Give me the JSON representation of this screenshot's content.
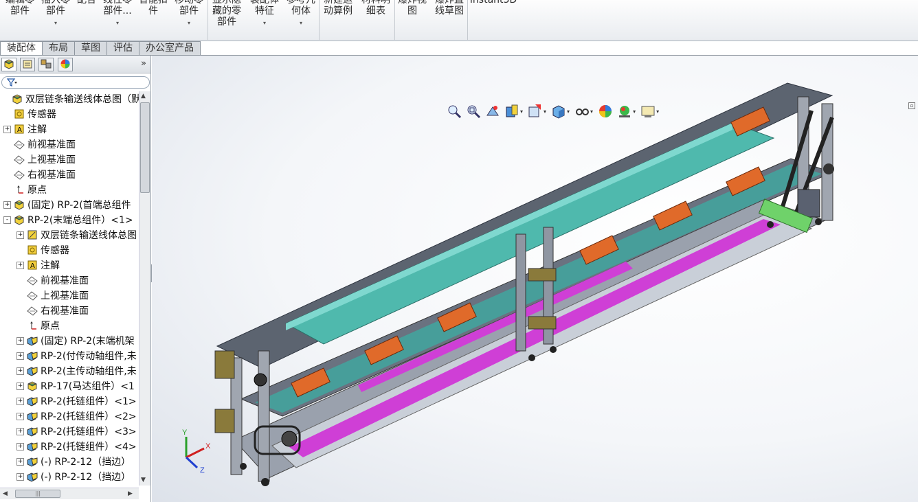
{
  "ribbon": {
    "buttons": [
      {
        "label": "编辑零\n部件",
        "dropdown": false
      },
      {
        "label": "插入零\n部件",
        "dropdown": true
      },
      {
        "label": "配合",
        "dropdown": false
      },
      {
        "label": "线性零\n部件...",
        "dropdown": true
      },
      {
        "label": "智能扣\n件",
        "dropdown": false
      },
      {
        "label": "移动零\n部件",
        "dropdown": true
      },
      {
        "label": "显示隐\n藏的零\n部件",
        "dropdown": false
      },
      {
        "label": "装配体\n特征",
        "dropdown": true
      },
      {
        "label": "参考几\n何体",
        "dropdown": true
      },
      {
        "label": "新建运\n动算例",
        "dropdown": false
      },
      {
        "label": "材料明\n细表",
        "dropdown": false
      },
      {
        "label": "爆炸视\n图",
        "dropdown": false
      },
      {
        "label": "爆炸直\n线草图",
        "dropdown": false
      },
      {
        "label": "Instant3D",
        "dropdown": false
      }
    ]
  },
  "tabs": [
    "装配体",
    "布局",
    "草图",
    "评估",
    "办公室产品"
  ],
  "panel": {
    "chevron": "»",
    "filter_icon": "funnel-icon"
  },
  "tree": [
    {
      "label": "双层链条输送线体总图（默",
      "icon": "assembly-icon",
      "expander": "none",
      "level": 0
    },
    {
      "label": "传感器",
      "icon": "sensor-icon",
      "expander": "none",
      "level": 1
    },
    {
      "label": "注解",
      "icon": "annotation-icon",
      "expander": "+",
      "level": 1
    },
    {
      "label": "前视基准面",
      "icon": "plane-icon",
      "expander": "none",
      "level": 1
    },
    {
      "label": "上视基准面",
      "icon": "plane-icon",
      "expander": "none",
      "level": 1
    },
    {
      "label": "右视基准面",
      "icon": "plane-icon",
      "expander": "none",
      "level": 1
    },
    {
      "label": "原点",
      "icon": "origin-icon",
      "expander": "none",
      "level": 1
    },
    {
      "label": "(固定) RP-2(首端总组件",
      "icon": "subassembly-icon",
      "expander": "+",
      "level": 1
    },
    {
      "label": "RP-2(末端总组件）<1>",
      "icon": "subassembly-icon",
      "expander": "-",
      "level": 1
    },
    {
      "label": "双层链条输送线体总图",
      "icon": "history-icon",
      "expander": "+",
      "level": 2
    },
    {
      "label": "传感器",
      "icon": "sensor-icon",
      "expander": "none",
      "level": 2
    },
    {
      "label": "注解",
      "icon": "annotation-icon",
      "expander": "+",
      "level": 2
    },
    {
      "label": "前视基准面",
      "icon": "plane-icon",
      "expander": "none",
      "level": 2
    },
    {
      "label": "上视基准面",
      "icon": "plane-icon",
      "expander": "none",
      "level": 2
    },
    {
      "label": "右视基准面",
      "icon": "plane-icon",
      "expander": "none",
      "level": 2
    },
    {
      "label": "原点",
      "icon": "origin-icon",
      "expander": "none",
      "level": 2
    },
    {
      "label": "(固定) RP-2(末端机架",
      "icon": "component-icon",
      "expander": "+",
      "level": 2
    },
    {
      "label": "RP-2(付传动轴组件,未",
      "icon": "component-icon",
      "expander": "+",
      "level": 2
    },
    {
      "label": "RP-2(主传动轴组件,未",
      "icon": "component-icon",
      "expander": "+",
      "level": 2
    },
    {
      "label": "RP-17(马达组件）<1",
      "icon": "subassembly-icon",
      "expander": "+",
      "level": 2
    },
    {
      "label": "RP-2(托链组件）<1>",
      "icon": "component-icon",
      "expander": "+",
      "level": 2
    },
    {
      "label": "RP-2(托链组件）<2>",
      "icon": "component-icon",
      "expander": "+",
      "level": 2
    },
    {
      "label": "RP-2(托链组件）<3>",
      "icon": "component-icon",
      "expander": "+",
      "level": 2
    },
    {
      "label": "RP-2(托链组件）<4>",
      "icon": "component-icon",
      "expander": "+",
      "level": 2
    },
    {
      "label": "(-) RP-2-12（挡边）",
      "icon": "component-icon",
      "expander": "+",
      "level": 2
    },
    {
      "label": "(-) RP-2-12（挡边）",
      "icon": "component-icon",
      "expander": "+",
      "level": 2
    }
  ],
  "hud": [
    "zoom-to-fit-icon",
    "zoom-area-icon",
    "previous-view-icon",
    "section-view-icon",
    "view-orientation-icon",
    "display-style-icon",
    "hide-show-icon",
    "edit-appearance-icon",
    "apply-scene-icon",
    "view-settings-icon"
  ],
  "triad": {
    "x": "X",
    "y": "Y",
    "z": "Z"
  }
}
